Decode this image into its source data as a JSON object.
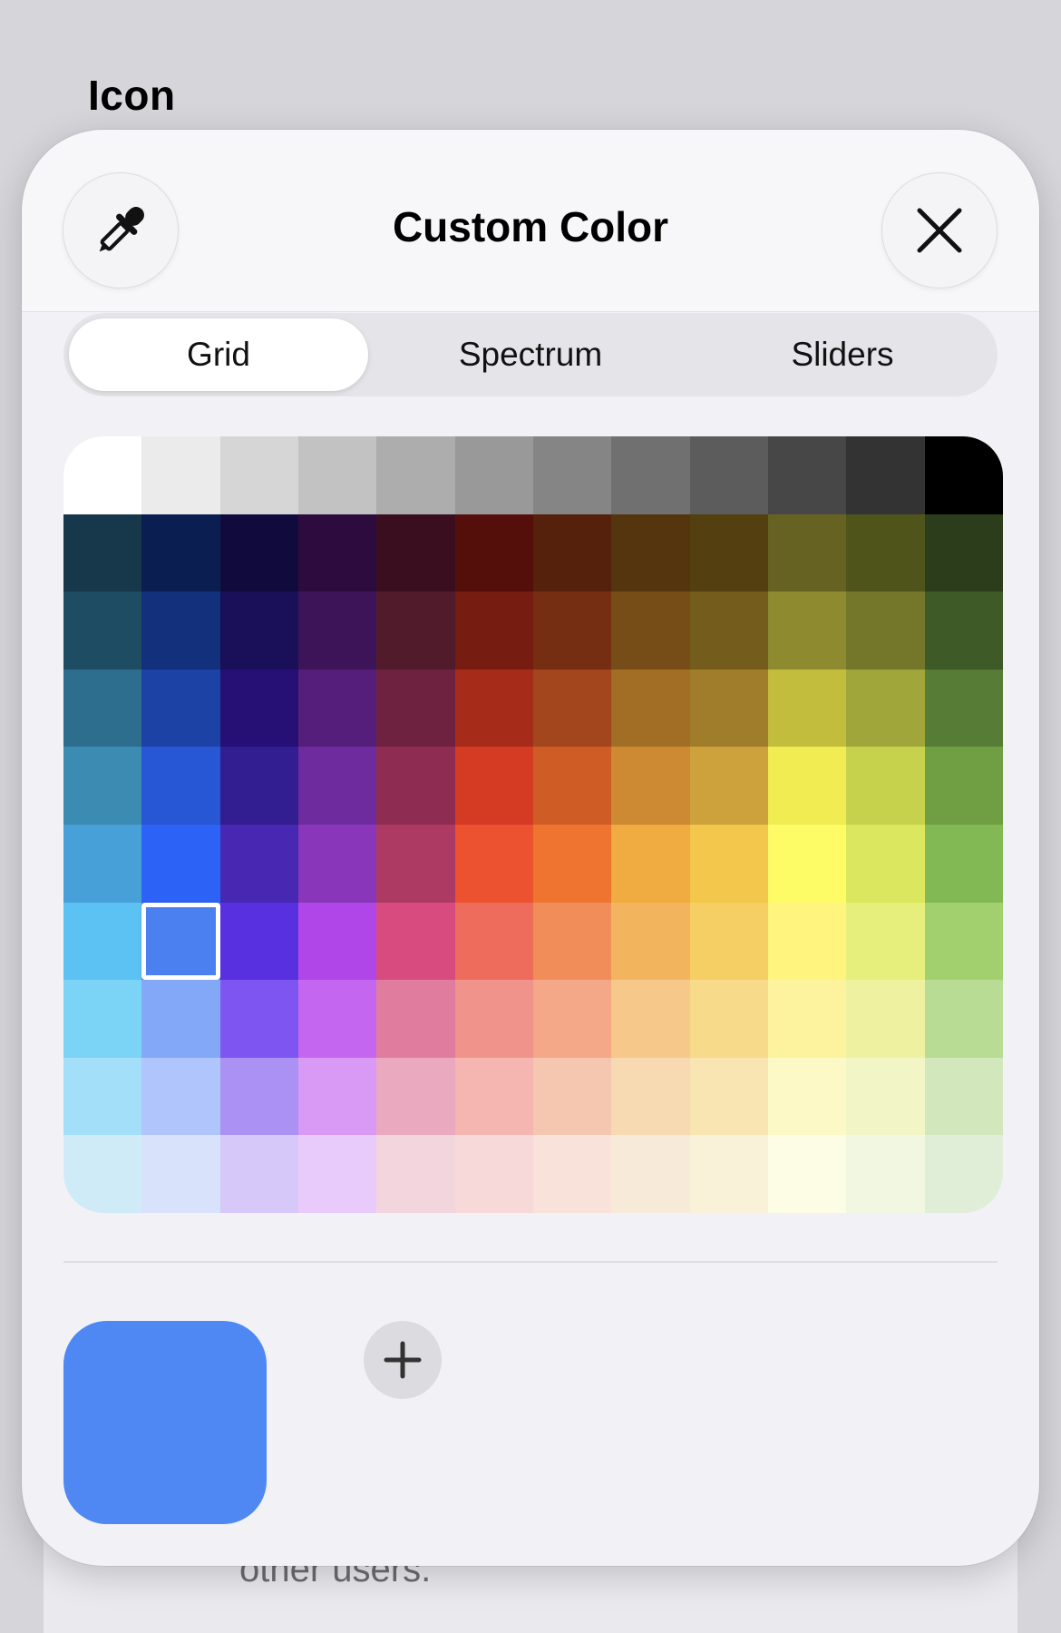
{
  "background": {
    "title": "Icon",
    "card_text": "other users."
  },
  "sheet": {
    "title": "Custom Color",
    "eyedropper_icon": "eyedropper-icon",
    "close_icon": "xmark-icon"
  },
  "tabs": [
    {
      "label": "Grid",
      "active": true
    },
    {
      "label": "Spectrum",
      "active": false
    },
    {
      "label": "Sliders",
      "active": false
    }
  ],
  "color_grid": {
    "rows": [
      [
        "#ffffff",
        "#ebebeb",
        "#d6d6d6",
        "#c2c2c2",
        "#adadad",
        "#999999",
        "#858585",
        "#707070",
        "#5c5c5c",
        "#474747",
        "#333333",
        "#000000"
      ],
      [
        "#16384a",
        "#0b1e52",
        "#110b3d",
        "#2e0b3e",
        "#3b0e1f",
        "#540f0b",
        "#55200c",
        "#55350d",
        "#533f10",
        "#666221",
        "#4f551a",
        "#2b3d1b"
      ],
      [
        "#1e4d63",
        "#12307b",
        "#1a0f59",
        "#3e1459",
        "#511b2c",
        "#771c11",
        "#752e12",
        "#764c17",
        "#735c1c",
        "#8d8a2f",
        "#747729",
        "#3d5a27"
      ],
      [
        "#2d6d8d",
        "#1c42a6",
        "#260f75",
        "#541e7a",
        "#6f223f",
        "#a62c19",
        "#a3451d",
        "#a26d25",
        "#a07d2b",
        "#c3bd3d",
        "#a0a63a",
        "#567c36"
      ],
      [
        "#3c8bb3",
        "#2757d4",
        "#321d91",
        "#6e2b9d",
        "#8e2c52",
        "#d53b23",
        "#cf5c25",
        "#cd8a33",
        "#cda13b",
        "#f1ec51",
        "#c6d24b",
        "#709e43"
      ],
      [
        "#47a1d8",
        "#2c62f5",
        "#4828b2",
        "#8a36bb",
        "#ad3a62",
        "#ec522f",
        "#ee7430",
        "#f0ab41",
        "#f3c74b",
        "#fefc66",
        "#dbe75e",
        "#83b955"
      ],
      [
        "#5cc2f3",
        "#4a80f0",
        "#5830e0",
        "#b046e8",
        "#d84b7e",
        "#ee6c5b",
        "#f18d58",
        "#f2b55d",
        "#f5cf63",
        "#fef47e",
        "#e7ef7c",
        "#a2d06f"
      ],
      [
        "#7bd3f6",
        "#83a8f7",
        "#7e55f1",
        "#c466f0",
        "#e07d9e",
        "#f0938a",
        "#f4a888",
        "#f6c889",
        "#f7da8a",
        "#fdf39f",
        "#eef2a0",
        "#b9dc94"
      ],
      [
        "#a4dff9",
        "#b0c5fb",
        "#ab91f3",
        "#d99af5",
        "#eba9c0",
        "#f5b6b2",
        "#f5c6b0",
        "#f7dab1",
        "#f8e5b2",
        "#fdf9c6",
        "#f2f5c5",
        "#d2e7bb"
      ],
      [
        "#d0ebf8",
        "#d9e2fb",
        "#d6c8f9",
        "#e8cbfa",
        "#f3d5de",
        "#f8d9d9",
        "#f8e2d9",
        "#f8ead8",
        "#faf1d9",
        "#fdfce5",
        "#f2f7e2",
        "#e1eed7"
      ]
    ],
    "selected_row": 6,
    "selected_col": 1
  },
  "current_color": "#4f87f3",
  "add_button_icon": "plus-icon"
}
